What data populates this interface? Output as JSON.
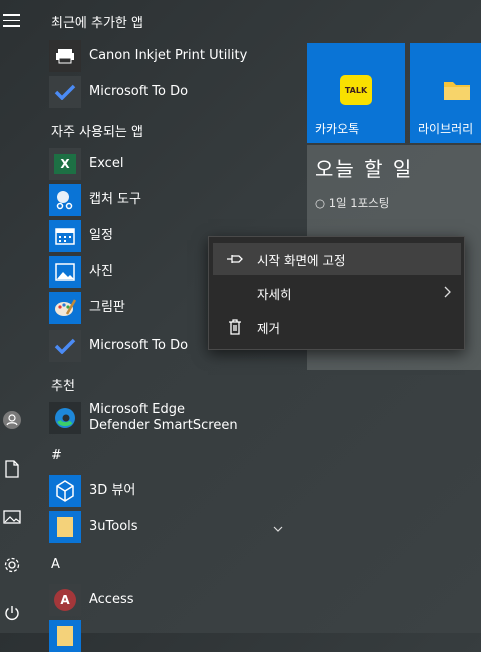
{
  "sections": {
    "recent": "최근에 추가한 앱",
    "frequent": "자주 사용되는 앱",
    "suggested": "추천",
    "hash": "#",
    "a": "A"
  },
  "apps": {
    "canon": "Canon Inkjet Print Utility",
    "todo1": "Microsoft To Do",
    "excel": "Excel",
    "snip": "캡처 도구",
    "calendar": "일정",
    "photos": "사진",
    "paint": "그림판",
    "todo2": "Microsoft To Do",
    "edge_line1": "Microsoft Edge",
    "edge_line2": "Defender SmartScreen",
    "viewer3d": "3D 뷰어",
    "utools": "3uTools",
    "access": "Access"
  },
  "tiles": {
    "kakao_label": "카카오톡",
    "kakao_badge": "TALK",
    "library_label": "라이브러리",
    "todo_title": "오늘 할 일",
    "todo_task": "1일 1포스팅"
  },
  "context_menu": {
    "pin": "시작 화면에 고정",
    "more": "자세히",
    "uninstall": "제거"
  },
  "colors": {
    "accent": "#0a74d6",
    "excel": "#1d7044",
    "access": "#a4373a"
  }
}
